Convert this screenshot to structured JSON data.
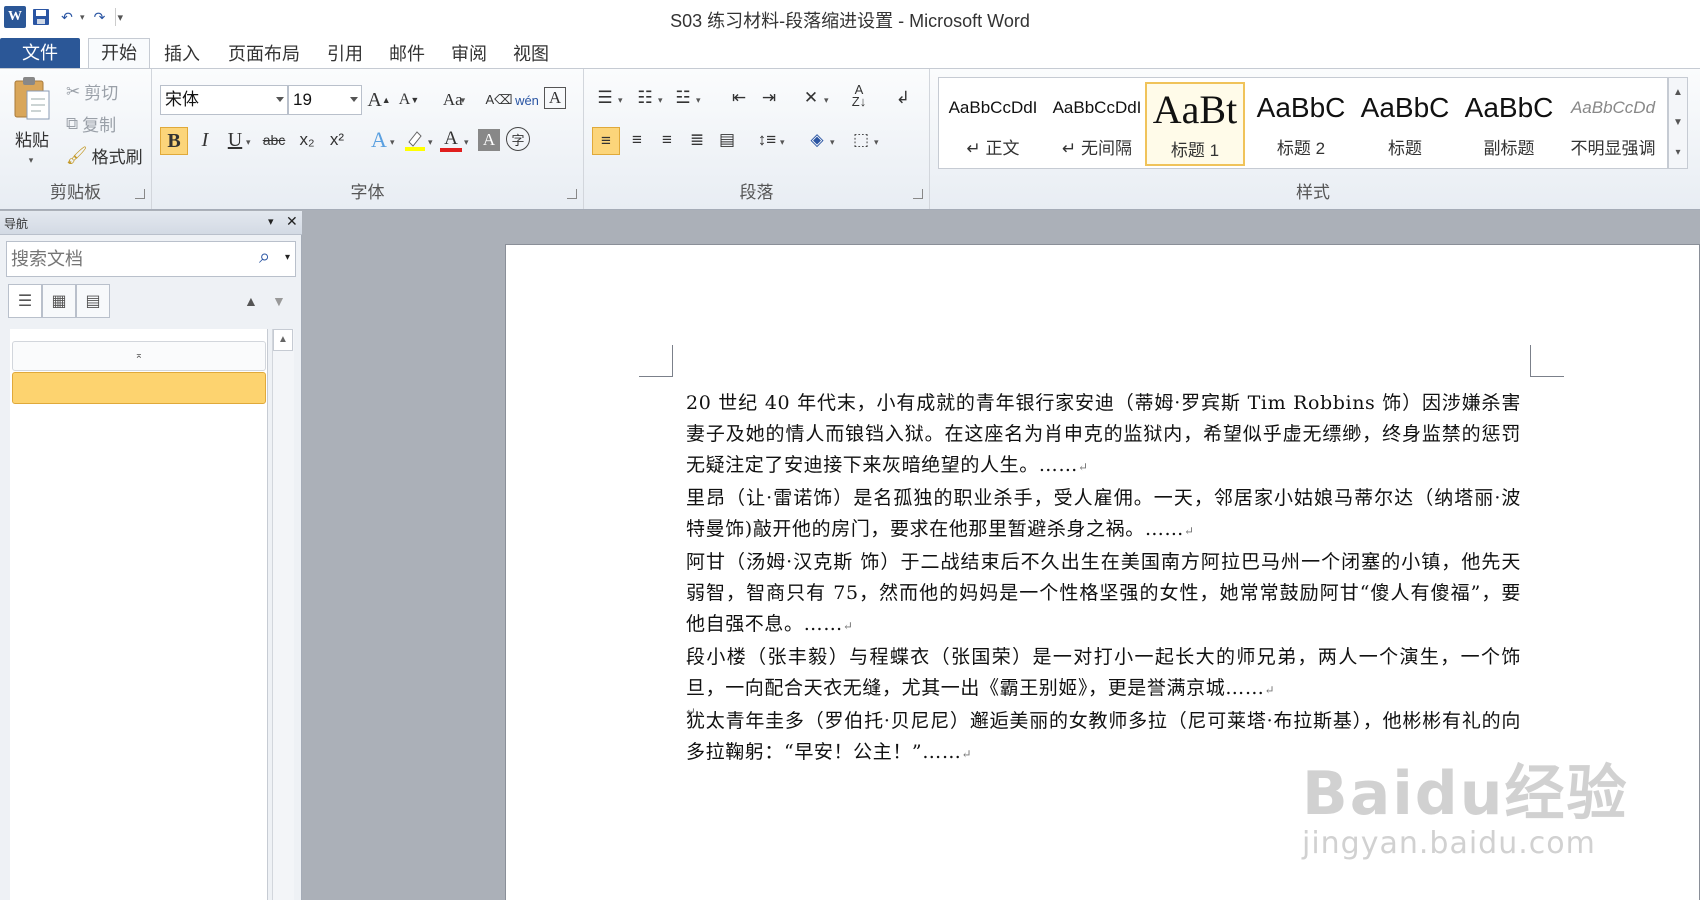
{
  "window": {
    "title": "S03 练习材料-段落缩进设置 - Microsoft Word"
  },
  "qat": {
    "app_icon": "W",
    "icons": [
      "save-icon",
      "undo-icon",
      "redo-icon",
      "customize-icon"
    ]
  },
  "tabs": [
    "文件",
    "开始",
    "插入",
    "页面布局",
    "引用",
    "邮件",
    "审阅",
    "视图"
  ],
  "active_tab": "开始",
  "clipboard": {
    "label": "剪贴板",
    "paste": "粘贴",
    "cut": "剪切",
    "copy": "复制",
    "format_painter": "格式刷"
  },
  "font": {
    "label": "字体",
    "font_name": "宋体",
    "font_size": "19",
    "grow": "A",
    "shrink": "A",
    "change_case": "Aa",
    "bold": "B",
    "italic": "I",
    "underline": "U",
    "strike": "abc",
    "subscript": "x₂",
    "superscript": "x²",
    "font_color_letter": "A",
    "highlight_color": "#ffff00",
    "font_color": "#e01e1e"
  },
  "paragraph": {
    "label": "段落"
  },
  "styles": {
    "label": "样式",
    "items": [
      {
        "sample": "AaBbCcDdI",
        "name": "↵ 正文"
      },
      {
        "sample": "AaBbCcDdI",
        "name": "↵ 无间隔"
      },
      {
        "sample": "AaBt",
        "name": "标题 1"
      },
      {
        "sample": "AaBbC",
        "name": "标题 2"
      },
      {
        "sample": "AaBbC",
        "name": "标题"
      },
      {
        "sample": "AaBbC",
        "name": "副标题"
      },
      {
        "sample": "AaBbCcDd",
        "name": "不明显强调"
      }
    ],
    "selected": "标题 1"
  },
  "nav": {
    "title": "导航",
    "search_placeholder": "搜索文档",
    "top_item_glyph": "⌅"
  },
  "document": {
    "paragraphs": [
      "20 世纪 40 年代末，小有成就的青年银行家安迪（蒂姆·罗宾斯 Tim Robbins 饰）因涉嫌杀害妻子及她的情人而锒铛入狱。在这座名为肖申克的监狱内，希望似乎虚无缥缈，终身监禁的惩罚无疑注定了安迪接下来灰暗绝望的人生。……",
      "里昂（让·雷诺饰）是名孤独的职业杀手，受人雇佣。一天，邻居家小姑娘马蒂尔达（纳塔丽·波特曼饰)敲开他的房门，要求在他那里暂避杀身之祸。……",
      "阿甘（汤姆·汉克斯 饰）于二战结束后不久出生在美国南方阿拉巴马州一个闭塞的小镇，他先天弱智，智商只有 75，然而他的妈妈是一个性格坚强的女性，她常常鼓励阿甘“傻人有傻福”，要他自强不息。……",
      "段小楼（张丰毅）与程蝶衣（张国荣）是一对打小一起长大的师兄弟，两人一个演生，一个饰旦，一向配合天衣无缝，尤其一出《霸王别姬》，更是誉满京城……",
      "犹太青年圭多（罗伯托·贝尼尼）邂逅美丽的女教师多拉（尼可莱塔·布拉斯基），他彬彬有礼的向多拉鞠躬：“早安！公主！”……"
    ],
    "pilcrow": "↵"
  },
  "watermark": {
    "brand": "Baidu经验",
    "url": "jingyan.baidu.com"
  }
}
